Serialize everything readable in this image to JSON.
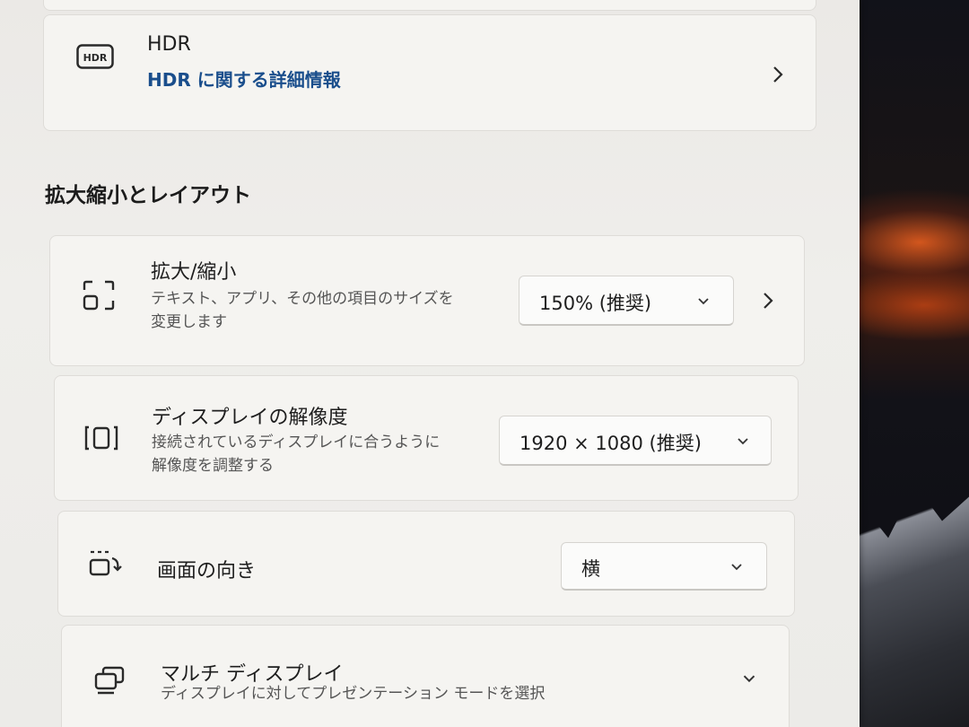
{
  "hdr": {
    "icon": "hdr-icon",
    "icon_text": "HDR",
    "title": "HDR",
    "link": "HDR に関する詳細情報"
  },
  "section": {
    "title": "拡大縮小とレイアウト"
  },
  "scale": {
    "icon": "scale-icon",
    "title": "拡大/縮小",
    "desc_line1": "テキスト、アプリ、その他の項目のサイズを",
    "desc_line2": "変更します",
    "value": "150% (推奨)"
  },
  "resolution": {
    "icon": "resolution-icon",
    "title": "ディスプレイの解像度",
    "desc_line1": "接続されているディスプレイに合うように",
    "desc_line2": "解像度を調整する",
    "value": "1920 × 1080 (推奨)"
  },
  "orientation": {
    "icon": "orientation-icon",
    "title": "画面の向き",
    "value": "横"
  },
  "multi": {
    "icon": "multi-display-icon",
    "title": "マルチ ディスプレイ",
    "desc": "ディスプレイに対してプレゼンテーション モードを選択"
  }
}
